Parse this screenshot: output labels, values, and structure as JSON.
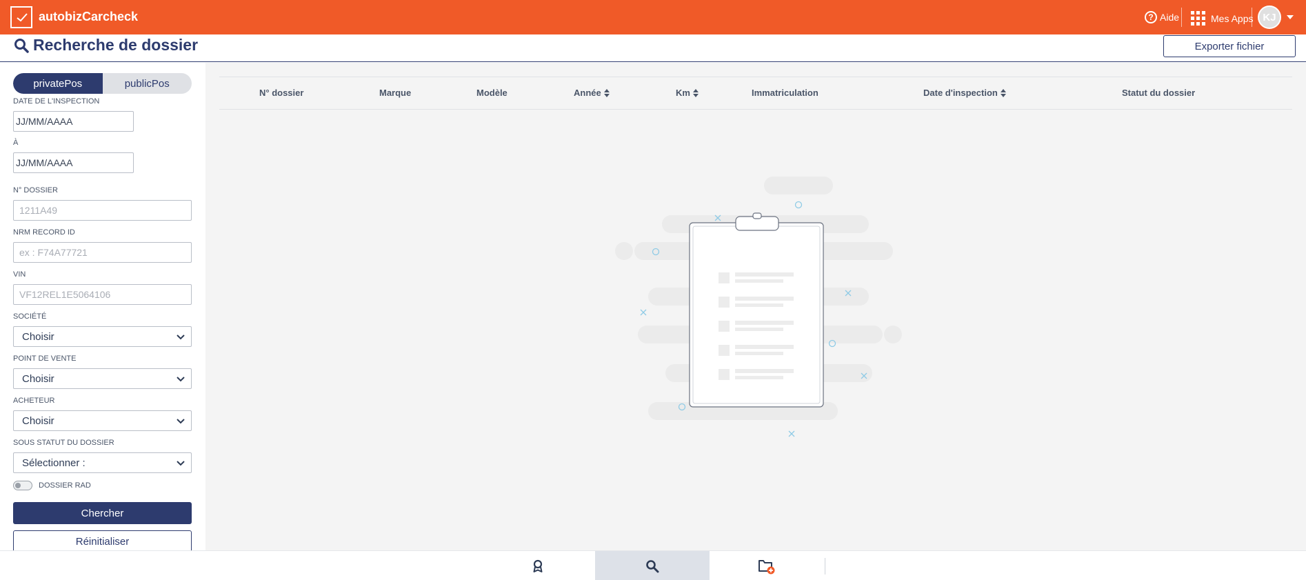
{
  "app": {
    "brand": "autobizCarcheck",
    "help_label": "Aide",
    "apps_label": "Mes Apps",
    "user_initials": "KJ"
  },
  "page": {
    "title": "Recherche de dossier",
    "export_label": "Exporter fichier"
  },
  "filters": {
    "tabs": [
      {
        "label": "privatePos",
        "active": true
      },
      {
        "label": "publicPos",
        "active": false
      }
    ],
    "date_from_label": "DATE DE L'INSPECTION",
    "date_from_placeholder": "JJ/MM/AAAA",
    "date_to_label": "À",
    "date_to_placeholder": "JJ/MM/AAAA",
    "dossier_label": "N° DOSSIER",
    "dossier_placeholder": "1211A49",
    "nrm_label": "NRM RECORD ID",
    "nrm_placeholder": "ex : F74A77721",
    "vin_label": "VIN",
    "vin_placeholder": "VF12REL1E5064106",
    "societe_label": "SOCIÉTÉ",
    "societe_value": "Choisir",
    "pdv_label": "POINT DE VENTE",
    "pdv_value": "Choisir",
    "acheteur_label": "ACHETEUR",
    "acheteur_value": "Choisir",
    "sous_statut_label": "SOUS STATUT DU DOSSIER",
    "sous_statut_value": "Sélectionner :",
    "rad_label": "DOSSIER RAD",
    "search_label": "Chercher",
    "reset_label": "Réinitialiser"
  },
  "table": {
    "columns": [
      "N° dossier",
      "Marque",
      "Modèle",
      "Année",
      "Km",
      "Immatriculation",
      "Date d'inspection",
      "Statut du dossier"
    ]
  },
  "colors": {
    "brand_orange": "#f05a28",
    "navy": "#2d3b6e"
  },
  "bottom_nav": {
    "items": [
      {
        "icon": "award-icon",
        "active": false
      },
      {
        "icon": "search-icon",
        "active": true
      },
      {
        "icon": "folder-add-icon",
        "active": false
      }
    ]
  }
}
